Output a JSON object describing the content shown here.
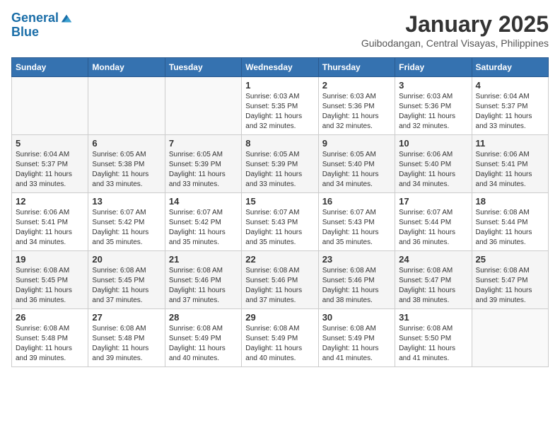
{
  "header": {
    "logo_line1": "General",
    "logo_line2": "Blue",
    "month_title": "January 2025",
    "location": "Guibodangan, Central Visayas, Philippines"
  },
  "days_of_week": [
    "Sunday",
    "Monday",
    "Tuesday",
    "Wednesday",
    "Thursday",
    "Friday",
    "Saturday"
  ],
  "weeks": [
    [
      {
        "day": "",
        "sunrise": "",
        "sunset": "",
        "daylight": ""
      },
      {
        "day": "",
        "sunrise": "",
        "sunset": "",
        "daylight": ""
      },
      {
        "day": "",
        "sunrise": "",
        "sunset": "",
        "daylight": ""
      },
      {
        "day": "1",
        "sunrise": "Sunrise: 6:03 AM",
        "sunset": "Sunset: 5:35 PM",
        "daylight": "Daylight: 11 hours and 32 minutes."
      },
      {
        "day": "2",
        "sunrise": "Sunrise: 6:03 AM",
        "sunset": "Sunset: 5:36 PM",
        "daylight": "Daylight: 11 hours and 32 minutes."
      },
      {
        "day": "3",
        "sunrise": "Sunrise: 6:03 AM",
        "sunset": "Sunset: 5:36 PM",
        "daylight": "Daylight: 11 hours and 32 minutes."
      },
      {
        "day": "4",
        "sunrise": "Sunrise: 6:04 AM",
        "sunset": "Sunset: 5:37 PM",
        "daylight": "Daylight: 11 hours and 33 minutes."
      }
    ],
    [
      {
        "day": "5",
        "sunrise": "Sunrise: 6:04 AM",
        "sunset": "Sunset: 5:37 PM",
        "daylight": "Daylight: 11 hours and 33 minutes."
      },
      {
        "day": "6",
        "sunrise": "Sunrise: 6:05 AM",
        "sunset": "Sunset: 5:38 PM",
        "daylight": "Daylight: 11 hours and 33 minutes."
      },
      {
        "day": "7",
        "sunrise": "Sunrise: 6:05 AM",
        "sunset": "Sunset: 5:39 PM",
        "daylight": "Daylight: 11 hours and 33 minutes."
      },
      {
        "day": "8",
        "sunrise": "Sunrise: 6:05 AM",
        "sunset": "Sunset: 5:39 PM",
        "daylight": "Daylight: 11 hours and 33 minutes."
      },
      {
        "day": "9",
        "sunrise": "Sunrise: 6:05 AM",
        "sunset": "Sunset: 5:40 PM",
        "daylight": "Daylight: 11 hours and 34 minutes."
      },
      {
        "day": "10",
        "sunrise": "Sunrise: 6:06 AM",
        "sunset": "Sunset: 5:40 PM",
        "daylight": "Daylight: 11 hours and 34 minutes."
      },
      {
        "day": "11",
        "sunrise": "Sunrise: 6:06 AM",
        "sunset": "Sunset: 5:41 PM",
        "daylight": "Daylight: 11 hours and 34 minutes."
      }
    ],
    [
      {
        "day": "12",
        "sunrise": "Sunrise: 6:06 AM",
        "sunset": "Sunset: 5:41 PM",
        "daylight": "Daylight: 11 hours and 34 minutes."
      },
      {
        "day": "13",
        "sunrise": "Sunrise: 6:07 AM",
        "sunset": "Sunset: 5:42 PM",
        "daylight": "Daylight: 11 hours and 35 minutes."
      },
      {
        "day": "14",
        "sunrise": "Sunrise: 6:07 AM",
        "sunset": "Sunset: 5:42 PM",
        "daylight": "Daylight: 11 hours and 35 minutes."
      },
      {
        "day": "15",
        "sunrise": "Sunrise: 6:07 AM",
        "sunset": "Sunset: 5:43 PM",
        "daylight": "Daylight: 11 hours and 35 minutes."
      },
      {
        "day": "16",
        "sunrise": "Sunrise: 6:07 AM",
        "sunset": "Sunset: 5:43 PM",
        "daylight": "Daylight: 11 hours and 35 minutes."
      },
      {
        "day": "17",
        "sunrise": "Sunrise: 6:07 AM",
        "sunset": "Sunset: 5:44 PM",
        "daylight": "Daylight: 11 hours and 36 minutes."
      },
      {
        "day": "18",
        "sunrise": "Sunrise: 6:08 AM",
        "sunset": "Sunset: 5:44 PM",
        "daylight": "Daylight: 11 hours and 36 minutes."
      }
    ],
    [
      {
        "day": "19",
        "sunrise": "Sunrise: 6:08 AM",
        "sunset": "Sunset: 5:45 PM",
        "daylight": "Daylight: 11 hours and 36 minutes."
      },
      {
        "day": "20",
        "sunrise": "Sunrise: 6:08 AM",
        "sunset": "Sunset: 5:45 PM",
        "daylight": "Daylight: 11 hours and 37 minutes."
      },
      {
        "day": "21",
        "sunrise": "Sunrise: 6:08 AM",
        "sunset": "Sunset: 5:46 PM",
        "daylight": "Daylight: 11 hours and 37 minutes."
      },
      {
        "day": "22",
        "sunrise": "Sunrise: 6:08 AM",
        "sunset": "Sunset: 5:46 PM",
        "daylight": "Daylight: 11 hours and 37 minutes."
      },
      {
        "day": "23",
        "sunrise": "Sunrise: 6:08 AM",
        "sunset": "Sunset: 5:46 PM",
        "daylight": "Daylight: 11 hours and 38 minutes."
      },
      {
        "day": "24",
        "sunrise": "Sunrise: 6:08 AM",
        "sunset": "Sunset: 5:47 PM",
        "daylight": "Daylight: 11 hours and 38 minutes."
      },
      {
        "day": "25",
        "sunrise": "Sunrise: 6:08 AM",
        "sunset": "Sunset: 5:47 PM",
        "daylight": "Daylight: 11 hours and 39 minutes."
      }
    ],
    [
      {
        "day": "26",
        "sunrise": "Sunrise: 6:08 AM",
        "sunset": "Sunset: 5:48 PM",
        "daylight": "Daylight: 11 hours and 39 minutes."
      },
      {
        "day": "27",
        "sunrise": "Sunrise: 6:08 AM",
        "sunset": "Sunset: 5:48 PM",
        "daylight": "Daylight: 11 hours and 39 minutes."
      },
      {
        "day": "28",
        "sunrise": "Sunrise: 6:08 AM",
        "sunset": "Sunset: 5:49 PM",
        "daylight": "Daylight: 11 hours and 40 minutes."
      },
      {
        "day": "29",
        "sunrise": "Sunrise: 6:08 AM",
        "sunset": "Sunset: 5:49 PM",
        "daylight": "Daylight: 11 hours and 40 minutes."
      },
      {
        "day": "30",
        "sunrise": "Sunrise: 6:08 AM",
        "sunset": "Sunset: 5:49 PM",
        "daylight": "Daylight: 11 hours and 41 minutes."
      },
      {
        "day": "31",
        "sunrise": "Sunrise: 6:08 AM",
        "sunset": "Sunset: 5:50 PM",
        "daylight": "Daylight: 11 hours and 41 minutes."
      },
      {
        "day": "",
        "sunrise": "",
        "sunset": "",
        "daylight": ""
      }
    ]
  ]
}
